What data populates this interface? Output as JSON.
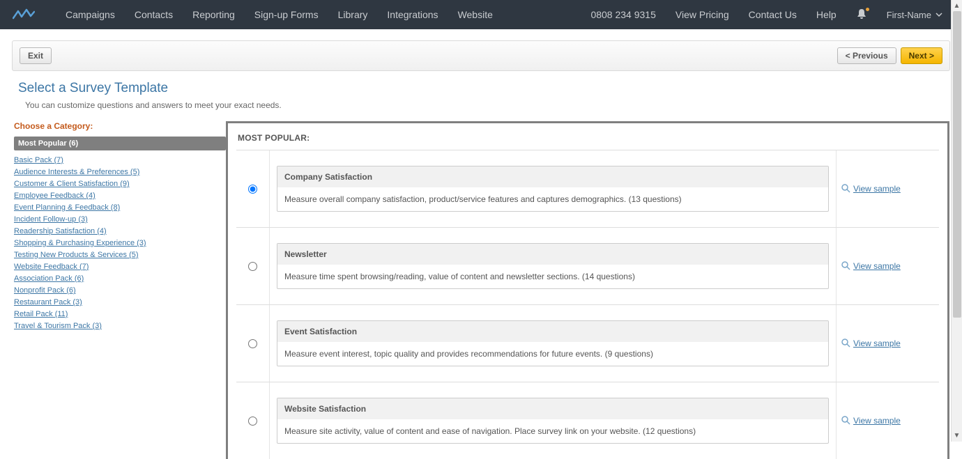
{
  "nav": {
    "left": [
      "Campaigns",
      "Contacts",
      "Reporting",
      "Sign-up Forms",
      "Library",
      "Integrations",
      "Website"
    ],
    "phone": "0808 234 9315",
    "right": [
      "View Pricing",
      "Contact Us",
      "Help"
    ],
    "user": "First-Name"
  },
  "toolbar": {
    "exit": "Exit",
    "prev": "< Previous",
    "next": "Next >"
  },
  "heading": {
    "title": "Select a Survey Template",
    "subtitle": "You can customize questions and answers to meet your exact needs."
  },
  "sidebar": {
    "heading": "Choose a Category:",
    "active": "Most Popular (6)",
    "items": [
      "Basic Pack (7)",
      "Audience Interests & Preferences (5)",
      "Customer & Client Satisfaction (9)",
      "Employee Feedback (4)",
      "Event Planning & Feedback (8)",
      "Incident Follow-up (3)",
      "Readership Satisfaction (4)",
      "Shopping & Purchasing Experience (3)",
      "Testing New Products & Services (5)",
      "Website Feedback (7)",
      "Association Pack (6)",
      "Nonprofit Pack (6)",
      "Restaurant Pack (3)",
      "Retail Pack (11)",
      "Travel & Tourism Pack (3)"
    ]
  },
  "main": {
    "section_title": "MOST POPULAR:",
    "view_sample": "View sample",
    "templates": [
      {
        "title": "Company Satisfaction",
        "desc": "Measure overall company satisfaction, product/service features and captures demographics. (13 questions)",
        "selected": true
      },
      {
        "title": "Newsletter",
        "desc": "Measure time spent browsing/reading, value of content and newsletter sections. (14 questions)",
        "selected": false
      },
      {
        "title": "Event Satisfaction",
        "desc": "Measure event interest, topic quality and provides recommendations for future events. (9 questions)",
        "selected": false
      },
      {
        "title": "Website Satisfaction",
        "desc": "Measure site activity, value of content and ease of navigation. Place survey link on your website. (12 questions)",
        "selected": false
      }
    ]
  }
}
